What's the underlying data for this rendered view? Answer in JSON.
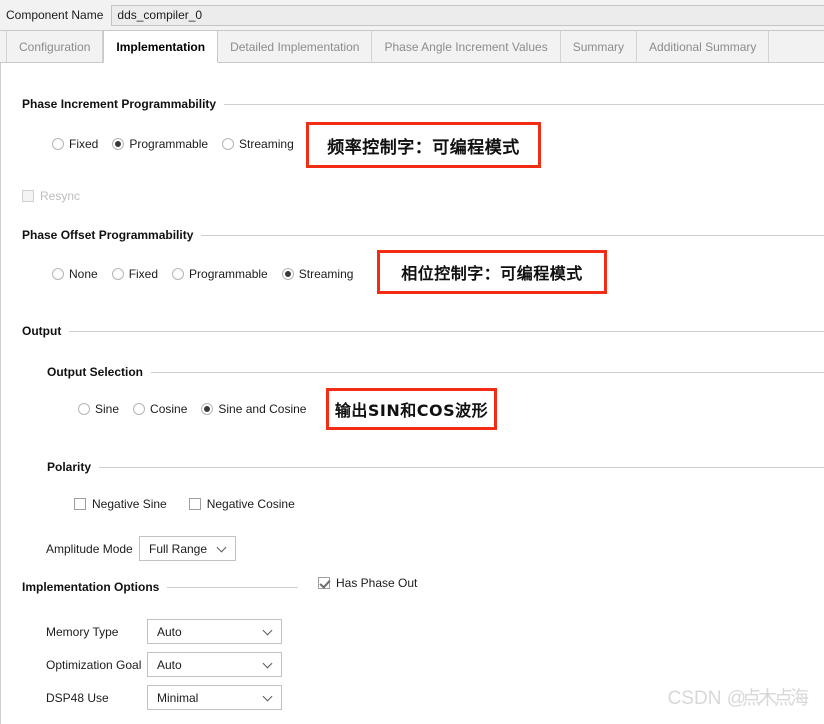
{
  "component": {
    "label": "Component Name",
    "value": "dds_compiler_0"
  },
  "tabs": [
    {
      "label": "Configuration",
      "active": false
    },
    {
      "label": "Implementation",
      "active": true
    },
    {
      "label": "Detailed Implementation",
      "active": false
    },
    {
      "label": "Phase Angle Increment Values",
      "active": false
    },
    {
      "label": "Summary",
      "active": false
    },
    {
      "label": "Additional Summary",
      "active": false
    }
  ],
  "phase_increment": {
    "title": "Phase Increment Programmability",
    "options": [
      {
        "label": "Fixed",
        "selected": false
      },
      {
        "label": "Programmable",
        "selected": true
      },
      {
        "label": "Streaming",
        "selected": false
      }
    ],
    "resync": {
      "label": "Resync",
      "checked": false,
      "enabled": false
    }
  },
  "phase_offset": {
    "title": "Phase Offset Programmability",
    "options": [
      {
        "label": "None",
        "selected": false
      },
      {
        "label": "Fixed",
        "selected": false
      },
      {
        "label": "Programmable",
        "selected": false
      },
      {
        "label": "Streaming",
        "selected": true
      }
    ]
  },
  "output": {
    "title": "Output",
    "selection": {
      "title": "Output Selection",
      "options": [
        {
          "label": "Sine",
          "selected": false
        },
        {
          "label": "Cosine",
          "selected": false
        },
        {
          "label": "Sine and Cosine",
          "selected": true
        }
      ]
    },
    "polarity": {
      "title": "Polarity",
      "options": [
        {
          "label": "Negative Sine",
          "checked": false
        },
        {
          "label": "Negative Cosine",
          "checked": false
        }
      ]
    },
    "amplitude_mode": {
      "label": "Amplitude Mode",
      "value": "Full Range"
    }
  },
  "implementation_options": {
    "title": "Implementation Options",
    "fields": [
      {
        "label": "Memory Type",
        "value": "Auto"
      },
      {
        "label": "Optimization Goal",
        "value": "Auto"
      },
      {
        "label": "DSP48 Use",
        "value": "Minimal"
      }
    ]
  },
  "has_phase_out": {
    "label": "Has Phase Out",
    "checked": true
  },
  "annotations": [
    {
      "text": "频率控制字：可编程模式"
    },
    {
      "text": "相位控制字：可编程模式"
    },
    {
      "text": "输出SIN和COS波形"
    }
  ],
  "watermark": {
    "prefix": "CSDN @",
    "suffix": "点木点海"
  },
  "colors": {
    "annotation_border": "#f22d13",
    "tab_active_text": "#000000",
    "tab_inactive_text": "#8c8c8c"
  }
}
